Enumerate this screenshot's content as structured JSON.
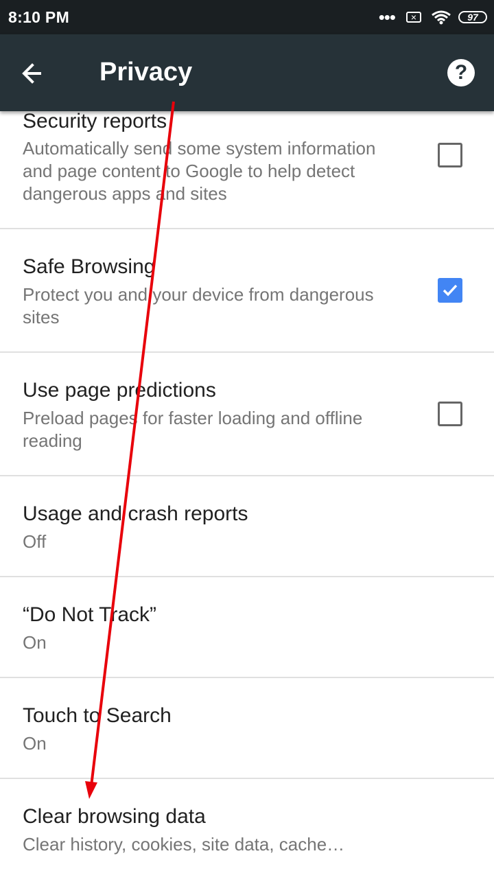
{
  "status_bar": {
    "time": "8:10 PM",
    "dots": "•••",
    "battery": "97"
  },
  "app_bar": {
    "title": "Privacy"
  },
  "settings": [
    {
      "title": "Security reports",
      "summary": "Automatically send some system information and page content to Google to help detect dangerous apps and sites",
      "checkbox": "unchecked"
    },
    {
      "title": "Safe Browsing",
      "summary": "Protect you and your device from dangerous sites",
      "checkbox": "checked"
    },
    {
      "title": "Use page predictions",
      "summary": "Preload pages for faster loading and offline reading",
      "checkbox": "unchecked"
    },
    {
      "title": "Usage and crash reports",
      "summary": "Off"
    },
    {
      "title": "“Do Not Track”",
      "summary": "On"
    },
    {
      "title": "Touch to Search",
      "summary": "On"
    },
    {
      "title": "Clear browsing data",
      "summary": "Clear history, cookies, site data, cache…"
    }
  ],
  "annotation": {
    "arrow_color": "#e8000b"
  }
}
